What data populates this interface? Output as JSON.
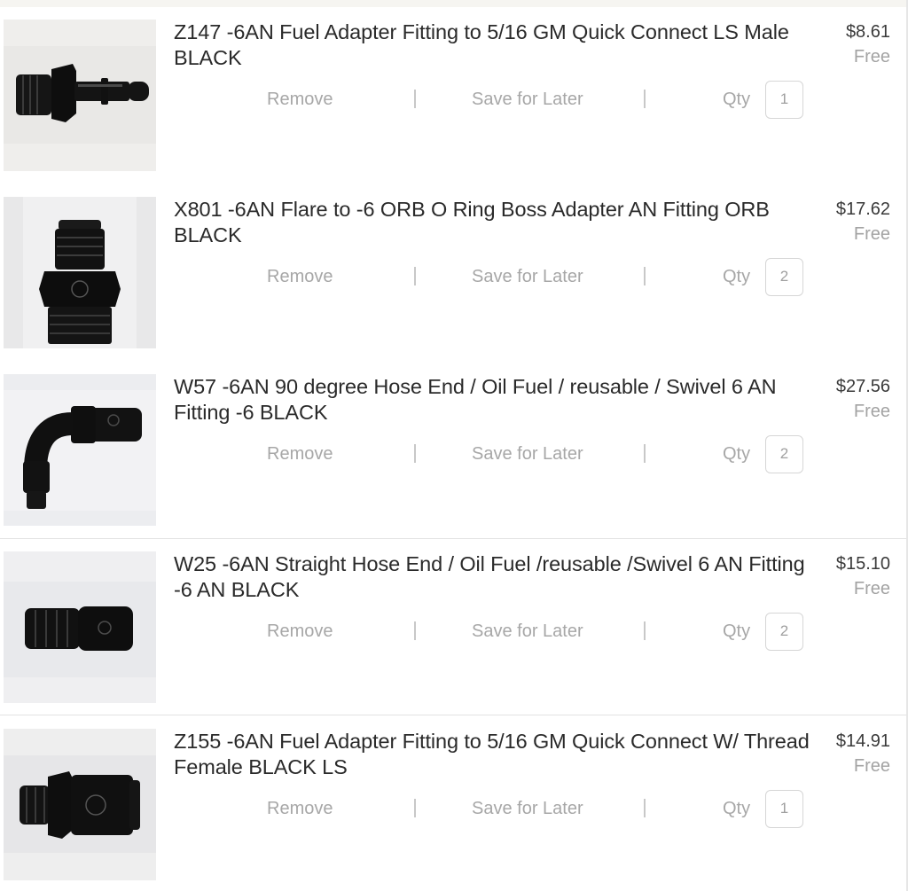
{
  "cart": {
    "items": [
      {
        "title": "Z147 -6AN Fuel Adapter Fitting to 5/16 GM Quick Connect LS Male BLACK",
        "price": "$8.61",
        "shipping": "Free",
        "remove_label": "Remove",
        "save_label": "Save for Later",
        "qty_label": "Qty",
        "qty": "1",
        "image_icon": "fitting-straight-adapter-icon"
      },
      {
        "title": "X801 -6AN Flare to -6 ORB O Ring Boss Adapter AN Fitting ORB BLACK",
        "price": "$17.62",
        "shipping": "Free",
        "remove_label": "Remove",
        "save_label": "Save for Later",
        "qty_label": "Qty",
        "qty": "2",
        "image_icon": "fitting-orb-adapter-icon"
      },
      {
        "title": "W57 -6AN 90 degree Hose End / Oil Fuel / reusable / Swivel 6 AN Fitting -6 BLACK",
        "price": "$27.56",
        "shipping": "Free",
        "remove_label": "Remove",
        "save_label": "Save for Later",
        "qty_label": "Qty",
        "qty": "2",
        "image_icon": "fitting-90-degree-hose-end-icon"
      },
      {
        "title": "W25 -6AN Straight Hose End / Oil Fuel /reusable /Swivel 6 AN Fitting -6 AN BLACK",
        "price": "$15.10",
        "shipping": "Free",
        "remove_label": "Remove",
        "save_label": "Save for Later",
        "qty_label": "Qty",
        "qty": "2",
        "image_icon": "fitting-straight-hose-end-icon"
      },
      {
        "title": "Z155 -6AN Fuel Adapter Fitting to 5/16 GM Quick Connect W/ Thread Female BLACK LS",
        "price": "$14.91",
        "shipping": "Free",
        "remove_label": "Remove",
        "save_label": "Save for Later",
        "qty_label": "Qty",
        "qty": "1",
        "image_icon": "fitting-quick-connect-female-icon"
      }
    ]
  },
  "colors": {
    "text": "#2a2a2a",
    "muted": "#a7a7a7",
    "fitting": "#111111",
    "photo_bg": "#ededee"
  }
}
